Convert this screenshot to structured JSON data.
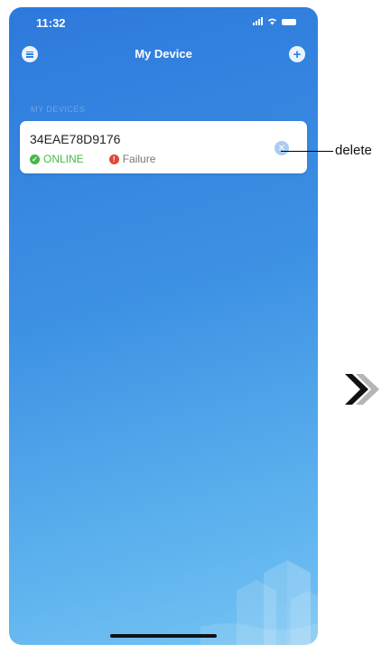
{
  "status_bar": {
    "time": "11:32"
  },
  "header": {
    "title": "My Device",
    "menu_icon": "menu-icon",
    "add_icon": "plus-icon"
  },
  "group": {
    "label": "MY DEVICES"
  },
  "device": {
    "id": "34EAE78D9176",
    "online_label": "ONLINE",
    "failure_label": "Failure"
  },
  "annotation": {
    "delete_label": "delete"
  },
  "colors": {
    "online": "#46b847",
    "failure": "#e0463a",
    "gradient_top": "#2d79dc",
    "gradient_bottom": "#74c3f2"
  }
}
